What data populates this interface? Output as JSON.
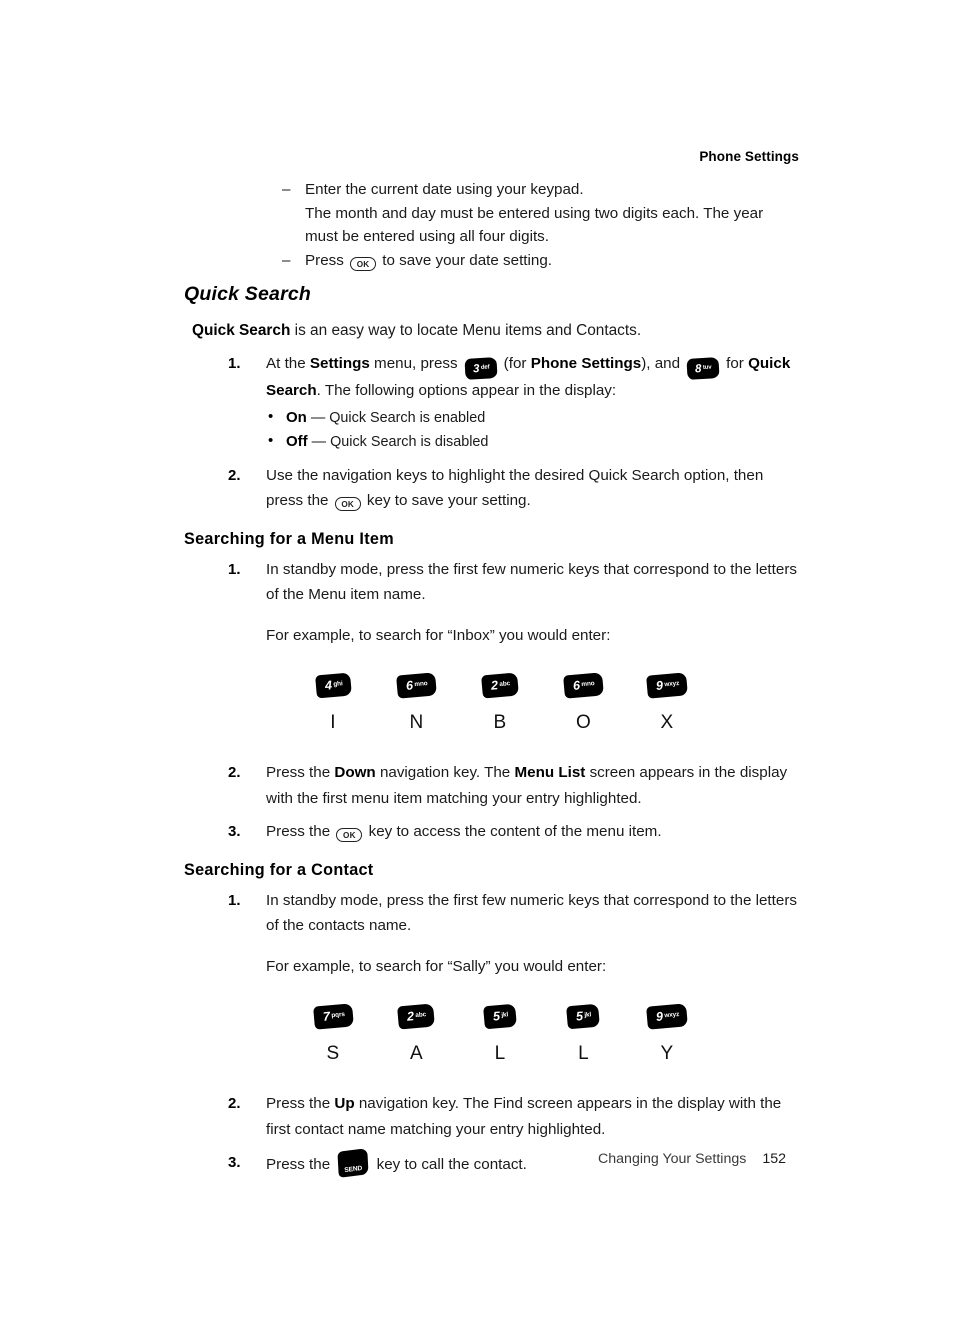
{
  "running_head": "Phone Settings",
  "date_steps": [
    {
      "mark": "–",
      "line1": "Enter the current date using your keypad.",
      "line2": "The month and day must be entered using two digits each. The year must be entered using all four digits."
    },
    {
      "mark": "–",
      "before": "Press",
      "key": "OK",
      "after": "to save your date setting."
    }
  ],
  "quick_search": {
    "title": "Quick Search",
    "intro_bold": "Quick Search",
    "intro_rest": " is an easy way to locate Menu items and Contacts.",
    "step1": {
      "num": "1.",
      "t1": "At the ",
      "b1": "Settings",
      "t2": " menu, press ",
      "key1_digit": "3",
      "key1_letters": "def",
      "t3": " (for ",
      "b2": "Phone Settings",
      "t4": "), and ",
      "key2_digit": "8",
      "key2_letters": "tuv",
      "t5": " for ",
      "b3": "Quick Search",
      "t6": ". The following options appear in the display:"
    },
    "options": [
      {
        "bullet": "•",
        "label": "On",
        "dash": "—",
        "desc": "Quick Search is enabled"
      },
      {
        "bullet": "•",
        "label": "Off",
        "dash": "—",
        "desc": "Quick Search is disabled"
      }
    ],
    "step2": {
      "num": "2.",
      "t1": "Use the navigation keys to highlight the desired Quick Search option, then press the ",
      "key": "OK",
      "t2": " key to save your setting."
    }
  },
  "menu_item_section": {
    "title": "Searching for a Menu Item",
    "step1": {
      "num": "1.",
      "text": "In standby mode, press the first few numeric keys that correspond to the letters of the Menu item name.",
      "example": "For example, to search for “Inbox” you would enter:"
    },
    "key_sequence": [
      {
        "digit": "4",
        "letters": "ghi",
        "letter": "I"
      },
      {
        "digit": "6",
        "letters": "mno",
        "letter": "N"
      },
      {
        "digit": "2",
        "letters": "abc",
        "letter": "B"
      },
      {
        "digit": "6",
        "letters": "mno",
        "letter": "O"
      },
      {
        "digit": "9",
        "letters": "wxyz",
        "letter": "X"
      }
    ],
    "step2": {
      "num": "2.",
      "t1": "Press the ",
      "b1": "Down",
      "t2": " navigation key. The ",
      "b2": "Menu List",
      "t3": " screen appears in the display with the first menu item matching your entry highlighted."
    },
    "step3": {
      "num": "3.",
      "t1": "Press the ",
      "key": "OK",
      "t2": " key to access the content of the menu item."
    }
  },
  "contact_section": {
    "title": "Searching for a Contact",
    "step1": {
      "num": "1.",
      "text": "In standby mode, press the first few numeric keys that correspond to the letters of the contacts name.",
      "example": "For example, to search for “Sally” you would enter:"
    },
    "key_sequence": [
      {
        "digit": "7",
        "letters": "pqrs",
        "letter": "S"
      },
      {
        "digit": "2",
        "letters": "abc",
        "letter": "A"
      },
      {
        "digit": "5",
        "letters": "jkl",
        "letter": "L"
      },
      {
        "digit": "5",
        "letters": "jkl",
        "letter": "L"
      },
      {
        "digit": "9",
        "letters": "wxyz",
        "letter": "Y"
      }
    ],
    "step2": {
      "num": "2.",
      "t1": "Press the ",
      "b1": "Up",
      "t2": " navigation key. The Find screen appears in the display with the first contact name matching your entry highlighted."
    },
    "step3": {
      "num": "3.",
      "t1": "Press the ",
      "key": "SEND",
      "t2": " key to call the contact."
    }
  },
  "footer": {
    "label": "Changing Your Settings",
    "page_number": "152"
  }
}
